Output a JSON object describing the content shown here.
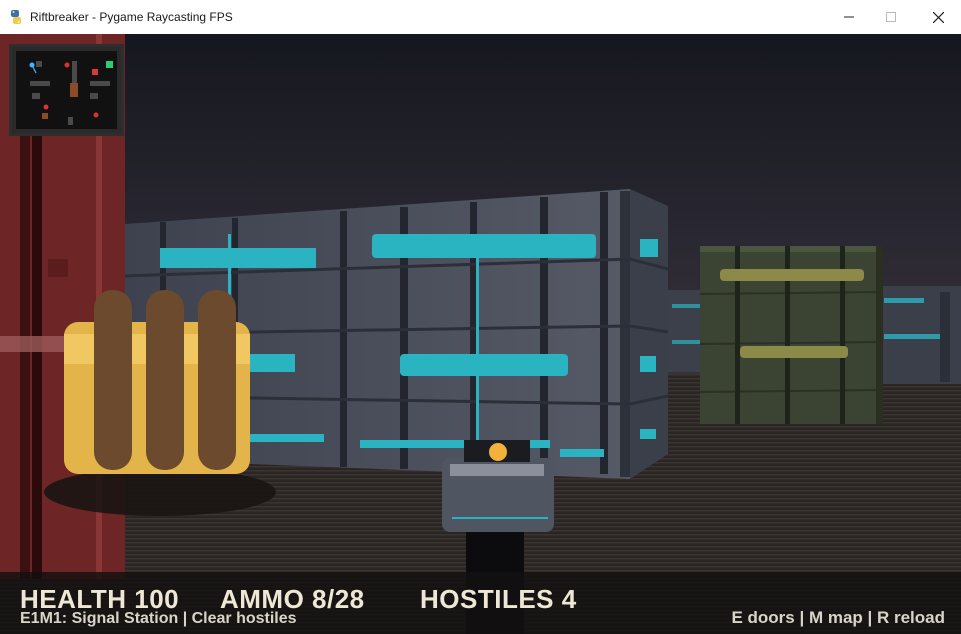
{
  "window": {
    "title": "Riftbreaker - Pygame Raycasting FPS",
    "icon": "python-icon",
    "controls": [
      "minimize-icon",
      "maximize-icon",
      "close-icon"
    ]
  },
  "hud": {
    "health": "HEALTH 100",
    "ammo": "AMMO 8/28",
    "hostiles": "HOSTILES 4",
    "level": "E1M1: Signal Station | Clear hostiles",
    "controls": "E doors | M map | R reload"
  },
  "colors": {
    "accent_cyan": "#2ab3c0",
    "wall_steel": "#4a4f5c",
    "wall_green": "#3a4230",
    "pickup_gold": "#e2b449",
    "door_red": "#7a2b2b",
    "hud_text": "#efe7d6"
  }
}
